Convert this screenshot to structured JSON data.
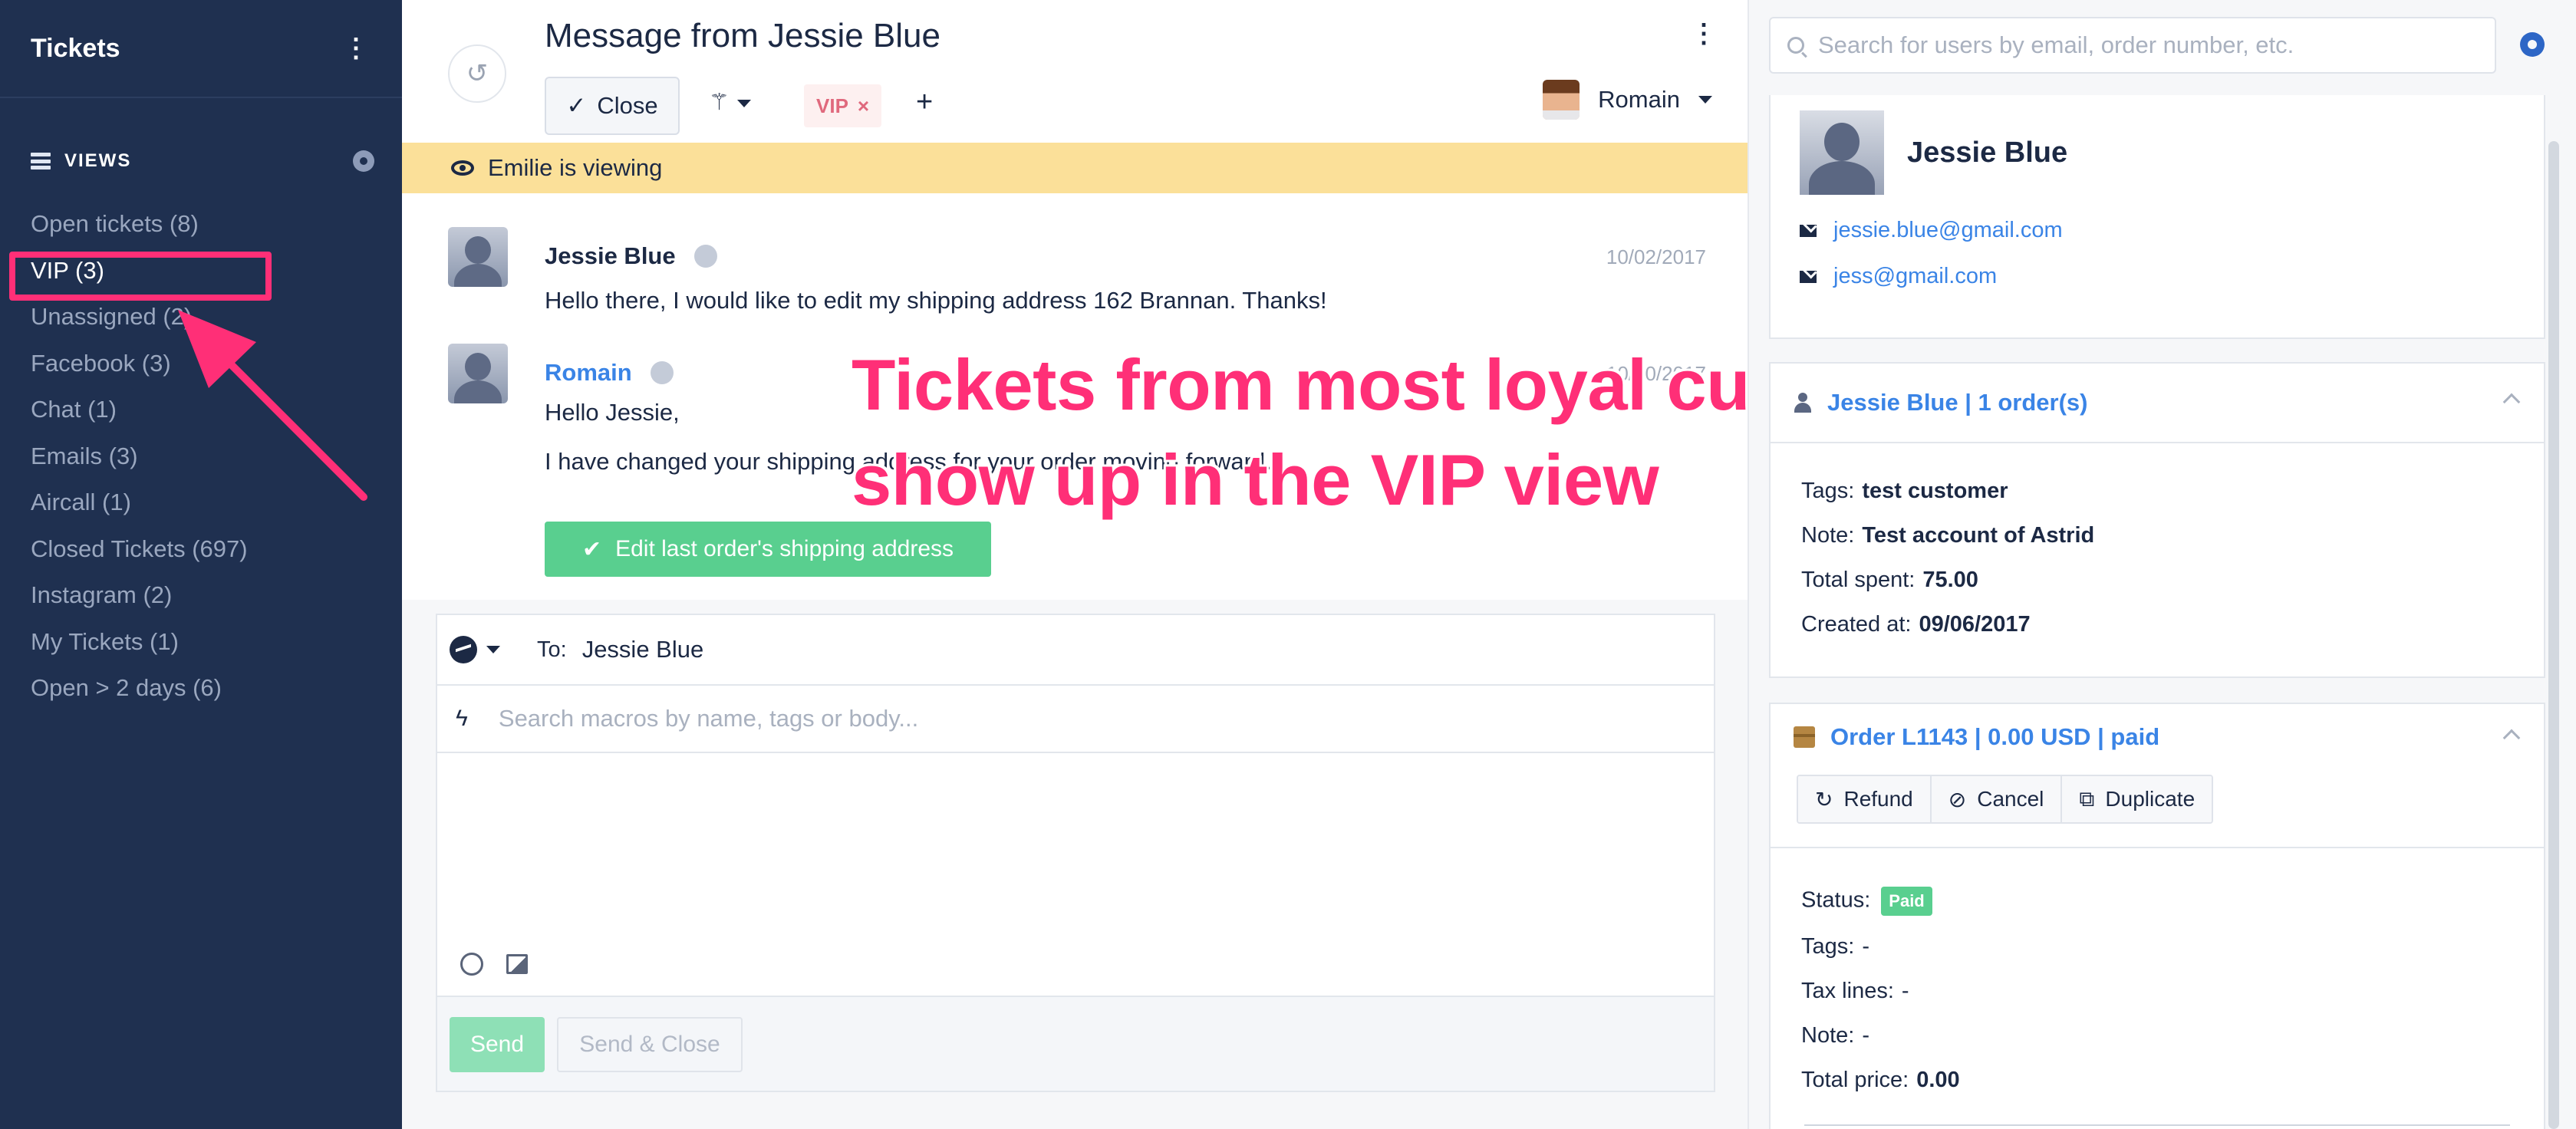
{
  "sidebar": {
    "title": "Tickets",
    "views_label": "VIEWS",
    "items": [
      {
        "label": "Open tickets (8)"
      },
      {
        "label": "VIP (3)"
      },
      {
        "label": "Unassigned (2)"
      },
      {
        "label": "Facebook (3)"
      },
      {
        "label": "Chat (1)"
      },
      {
        "label": "Emails (3)"
      },
      {
        "label": "Aircall (1)"
      },
      {
        "label": "Closed Tickets (697)"
      },
      {
        "label": "Instagram (2)"
      },
      {
        "label": "My Tickets (1)"
      },
      {
        "label": "Open > 2 days (6)"
      }
    ]
  },
  "ticket": {
    "title": "Message from Jessie Blue",
    "close_label": "Close",
    "tag_label": "VIP",
    "tag_remove": "×",
    "add_tag": "+",
    "assignee": "Romain",
    "viewing_text": "Emilie is viewing"
  },
  "messages": [
    {
      "author": "Jessie Blue",
      "date": "10/02/2017",
      "body": "Hello there, I would like to edit my shipping address 162 Brannan. Thanks!"
    },
    {
      "author": "Romain",
      "date": "10/10/2017",
      "greeting": "Hello Jessie,",
      "body": "I have changed your shipping address for your order moving forward."
    }
  ],
  "action_button": "Edit last order's shipping address",
  "annotation": {
    "line1": "Tickets from most loyal customers",
    "line2": "show up in the VIP view",
    "color": "#ff2f77"
  },
  "composer": {
    "to_label": "To:",
    "to_value": "Jessie Blue",
    "macro_placeholder": "Search macros by name, tags or body...",
    "send_label": "Send",
    "send_close_label": "Send & Close"
  },
  "right_panel": {
    "search_placeholder": "Search for users by email, order number, etc.",
    "user": {
      "name": "Jessie Blue",
      "emails": [
        "jessie.blue@gmail.com",
        "jess@gmail.com"
      ]
    },
    "customer_card": {
      "title": "Jessie Blue | 1 order(s)",
      "fields": [
        {
          "label": "Tags:",
          "value": "test customer"
        },
        {
          "label": "Note:",
          "value": "Test account of Astrid"
        },
        {
          "label": "Total spent:",
          "value": "75.00"
        },
        {
          "label": "Created at:",
          "value": "09/06/2017"
        }
      ]
    },
    "order_card": {
      "title": "Order L1143 | 0.00 USD | paid",
      "buttons": [
        "Refund",
        "Cancel",
        "Duplicate"
      ],
      "status_label": "Status:",
      "status_value": "Paid",
      "fields": [
        {
          "label": "Tags:",
          "value": "-"
        },
        {
          "label": "Tax lines:",
          "value": "-"
        },
        {
          "label": "Note:",
          "value": "-"
        },
        {
          "label": "Total price:",
          "value": "0.00"
        }
      ]
    }
  },
  "colors": {
    "sidebar_bg": "#1f3050",
    "accent_blue": "#3a84e6",
    "success_green": "#59cf8f",
    "viewing_yellow": "#fbe099",
    "highlight_pink": "#ff2f77"
  }
}
